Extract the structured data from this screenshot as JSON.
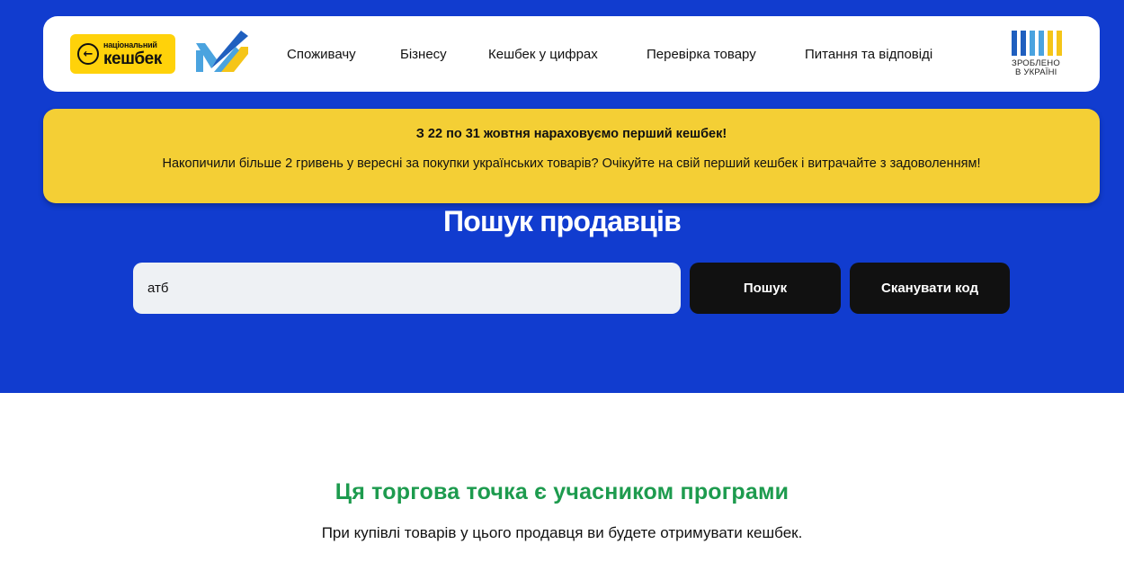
{
  "brand": {
    "logo_small_text": "національний",
    "logo_big_text": "кешбек",
    "made_in_line1": "ЗРОБЛЕНО",
    "made_in_line2": "В УКРАЇНІ"
  },
  "nav": [
    {
      "label": "Споживачу"
    },
    {
      "label": "Бізнесу"
    },
    {
      "label": "Кешбек у цифрах"
    },
    {
      "label": "Перевірка товару"
    },
    {
      "label": "Питання та відповіді"
    }
  ],
  "banner": {
    "title": "З 22 по 31 жовтня нараховуємо перший кешбек!",
    "text": "Накопичили більше 2 гривень у вересні за покупки українських товарів? Очікуйте на свій перший кешбек і витрачайте з задоволенням!"
  },
  "search": {
    "heading": "Пошук продавців",
    "value": "атб",
    "search_button": "Пошук",
    "scan_button": "Сканувати код"
  },
  "result": {
    "title": "Ця торгова точка є учасником програми",
    "text": "При купівлі товарів у цього продавця ви будете отримувати кешбек."
  },
  "colors": {
    "hero_bg": "#113ccf",
    "banner_bg": "#f4cf35",
    "brand_yellow": "#ffd20a",
    "success_green": "#1d9b4e",
    "button_dark": "#111111"
  }
}
